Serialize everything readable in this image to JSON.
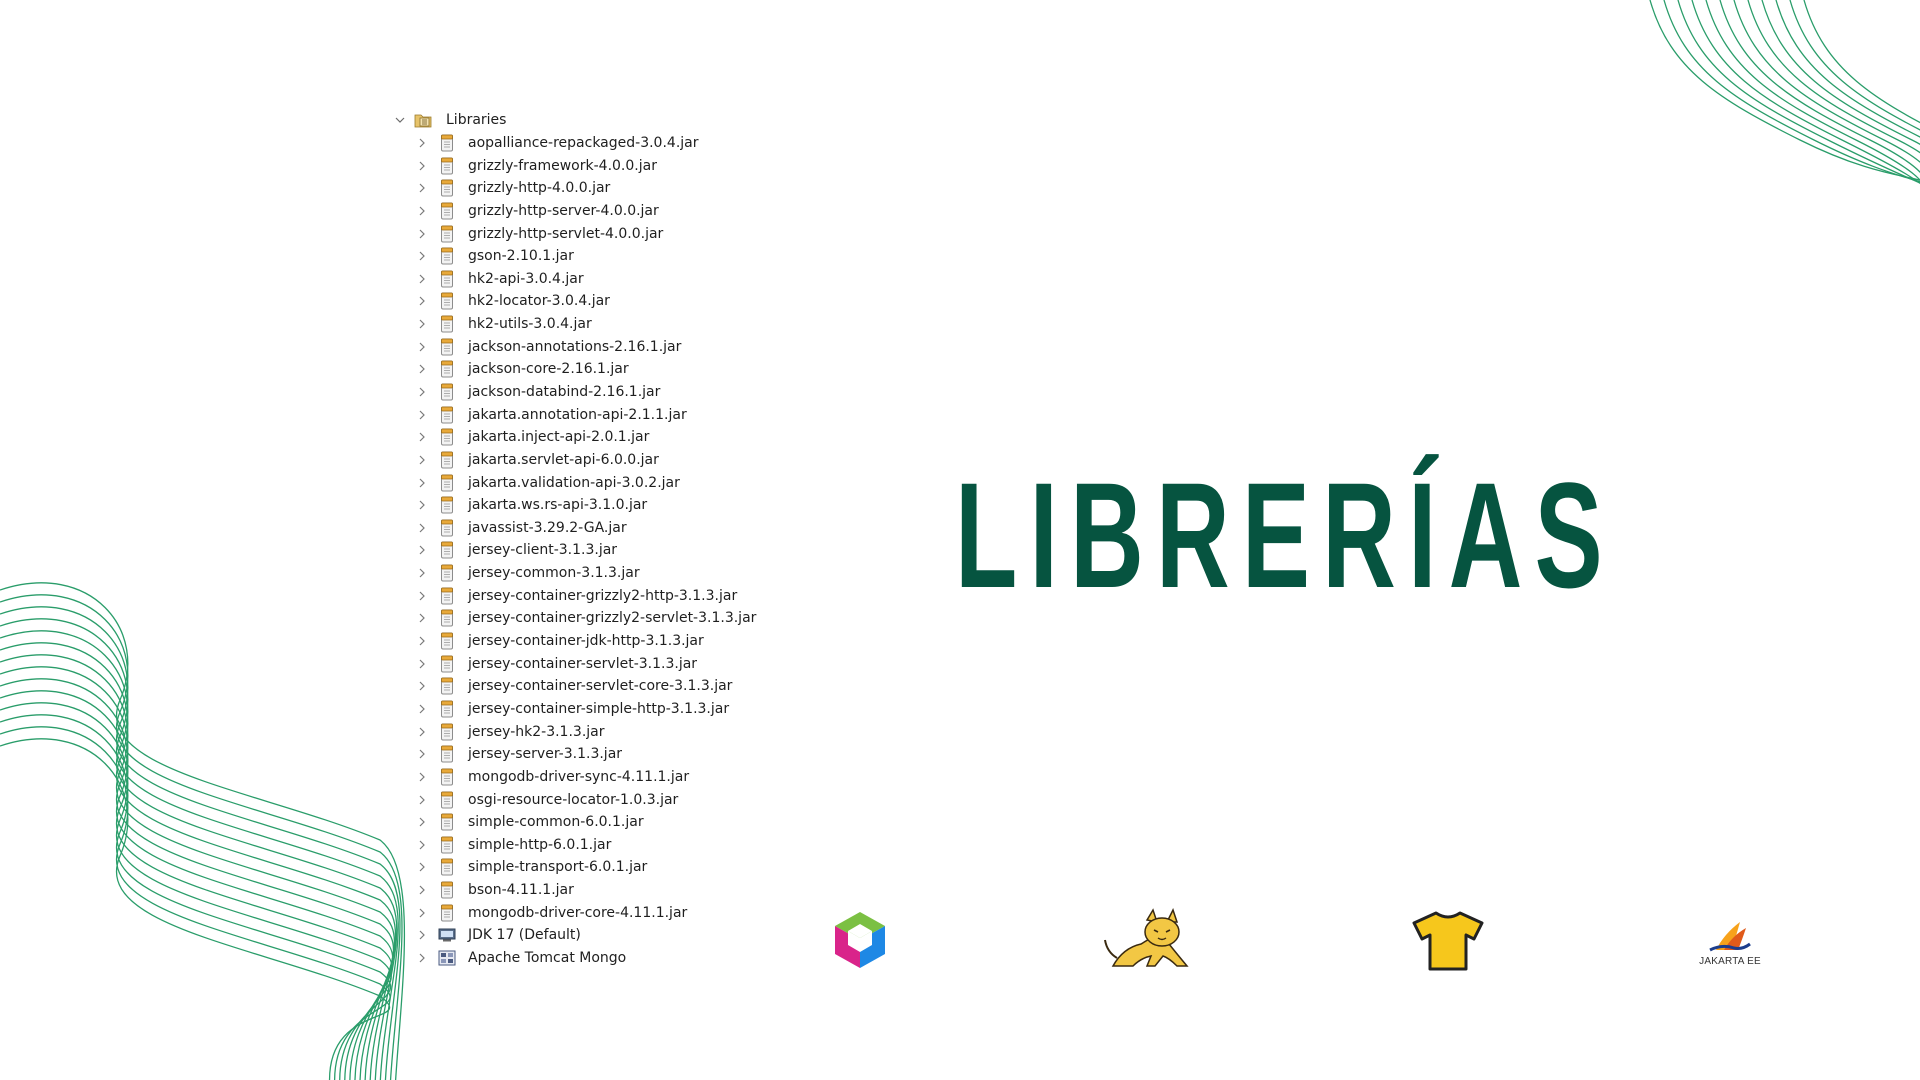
{
  "title": "LIBRERÍAS",
  "tree": {
    "root_label": "Libraries",
    "items": [
      {
        "label": "aopalliance-repackaged-3.0.4.jar",
        "icon": "jar-icon"
      },
      {
        "label": "grizzly-framework-4.0.0.jar",
        "icon": "jar-icon"
      },
      {
        "label": "grizzly-http-4.0.0.jar",
        "icon": "jar-icon"
      },
      {
        "label": "grizzly-http-server-4.0.0.jar",
        "icon": "jar-icon"
      },
      {
        "label": "grizzly-http-servlet-4.0.0.jar",
        "icon": "jar-icon"
      },
      {
        "label": "gson-2.10.1.jar",
        "icon": "jar-icon"
      },
      {
        "label": "hk2-api-3.0.4.jar",
        "icon": "jar-icon"
      },
      {
        "label": "hk2-locator-3.0.4.jar",
        "icon": "jar-icon"
      },
      {
        "label": "hk2-utils-3.0.4.jar",
        "icon": "jar-icon"
      },
      {
        "label": "jackson-annotations-2.16.1.jar",
        "icon": "jar-icon"
      },
      {
        "label": "jackson-core-2.16.1.jar",
        "icon": "jar-icon"
      },
      {
        "label": "jackson-databind-2.16.1.jar",
        "icon": "jar-icon"
      },
      {
        "label": "jakarta.annotation-api-2.1.1.jar",
        "icon": "jar-icon"
      },
      {
        "label": "jakarta.inject-api-2.0.1.jar",
        "icon": "jar-icon"
      },
      {
        "label": "jakarta.servlet-api-6.0.0.jar",
        "icon": "jar-icon"
      },
      {
        "label": "jakarta.validation-api-3.0.2.jar",
        "icon": "jar-icon"
      },
      {
        "label": "jakarta.ws.rs-api-3.1.0.jar",
        "icon": "jar-icon"
      },
      {
        "label": "javassist-3.29.2-GA.jar",
        "icon": "jar-icon"
      },
      {
        "label": "jersey-client-3.1.3.jar",
        "icon": "jar-icon"
      },
      {
        "label": "jersey-common-3.1.3.jar",
        "icon": "jar-icon"
      },
      {
        "label": "jersey-container-grizzly2-http-3.1.3.jar",
        "icon": "jar-icon"
      },
      {
        "label": "jersey-container-grizzly2-servlet-3.1.3.jar",
        "icon": "jar-icon"
      },
      {
        "label": "jersey-container-jdk-http-3.1.3.jar",
        "icon": "jar-icon"
      },
      {
        "label": "jersey-container-servlet-3.1.3.jar",
        "icon": "jar-icon"
      },
      {
        "label": "jersey-container-servlet-core-3.1.3.jar",
        "icon": "jar-icon"
      },
      {
        "label": "jersey-container-simple-http-3.1.3.jar",
        "icon": "jar-icon"
      },
      {
        "label": "jersey-hk2-3.1.3.jar",
        "icon": "jar-icon"
      },
      {
        "label": "jersey-server-3.1.3.jar",
        "icon": "jar-icon"
      },
      {
        "label": "mongodb-driver-sync-4.11.1.jar",
        "icon": "jar-icon"
      },
      {
        "label": "osgi-resource-locator-1.0.3.jar",
        "icon": "jar-icon"
      },
      {
        "label": "simple-common-6.0.1.jar",
        "icon": "jar-icon"
      },
      {
        "label": "simple-http-6.0.1.jar",
        "icon": "jar-icon"
      },
      {
        "label": "simple-transport-6.0.1.jar",
        "icon": "jar-icon"
      },
      {
        "label": "bson-4.11.1.jar",
        "icon": "jar-icon"
      },
      {
        "label": "mongodb-driver-core-4.11.1.jar",
        "icon": "jar-icon"
      },
      {
        "label": "JDK 17 (Default)",
        "icon": "jdk-icon"
      },
      {
        "label": "Apache Tomcat Mongo",
        "icon": "server-library-icon"
      }
    ]
  },
  "logos": {
    "netbeans": "netbeans-logo",
    "tomcat": "tomcat-logo",
    "glassfish": "glassfish-logo",
    "jakarta": "jakarta-ee-logo",
    "jakarta_label": "JAKARTA EE"
  },
  "colors": {
    "title": "#065440",
    "decorative_lines": "#2a9d6a",
    "jar_icon": "#e8a93a"
  }
}
